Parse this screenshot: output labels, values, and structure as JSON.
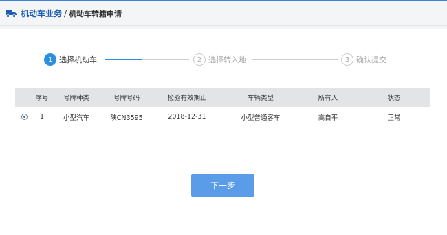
{
  "header": {
    "section": "机动车业务",
    "separator": "/",
    "page": "机动车转籍申请",
    "icon": "truck-icon"
  },
  "steps": [
    {
      "number": "1",
      "label": "选择机动车",
      "state": "active"
    },
    {
      "number": "2",
      "label": "选择转入地",
      "state": "inactive"
    },
    {
      "number": "3",
      "label": "确认提交",
      "state": "inactive"
    }
  ],
  "table": {
    "columns": [
      "",
      "序号",
      "号牌种类",
      "号牌号码",
      "检验有效期止",
      "车辆类型",
      "所有人",
      "状态"
    ],
    "rows": [
      {
        "selected": true,
        "index": "1",
        "plate_type": "小型汽车",
        "plate_number": "陕CN3595",
        "inspection_expiry": "2018-12-31",
        "vehicle_type": "小型普通客车",
        "owner": "高自平",
        "status": "正常"
      }
    ]
  },
  "next_button": "下一步",
  "colors": {
    "accent": "#2d8fe0",
    "button": "#5b9ce8",
    "brand_text": "#1c5db5"
  }
}
